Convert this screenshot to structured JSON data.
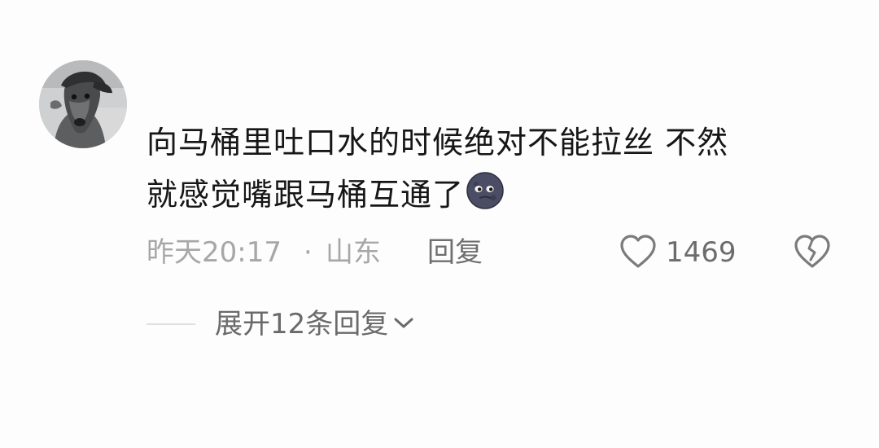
{
  "comment": {
    "avatar_icon": "dog-avatar-icon",
    "text_line1": "向马桶里吐口水的时候绝对不能拉丝 不然",
    "text_line2": "就感觉嘴跟马桶互通了",
    "emoji_icon": "new-moon-face-icon",
    "time": "昨天20:17",
    "separator": "·",
    "location": "山东",
    "reply_label": "回复",
    "like_icon": "heart-outline-icon",
    "like_count": "1469",
    "dislike_icon": "broken-heart-icon",
    "expand_label": "展开12条回复",
    "expand_icon": "chevron-down-icon"
  },
  "colors": {
    "background": "#fdfdfd",
    "text_primary": "#161616",
    "text_muted": "#a7a7a7",
    "text_secondary": "#6f6f6f",
    "icon_gray": "#7b7b7b"
  }
}
